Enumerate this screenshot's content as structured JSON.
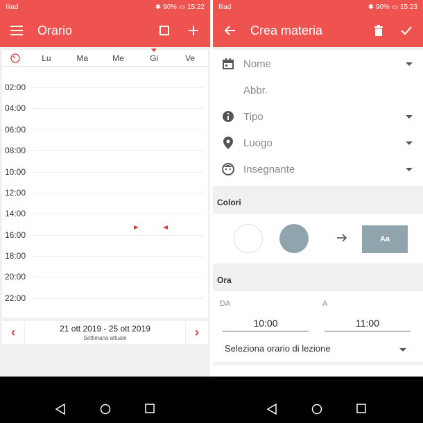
{
  "left": {
    "status": {
      "carrier": "Iliad",
      "battery": "90%",
      "time": "15:22"
    },
    "appbar": {
      "title": "Orario"
    },
    "days": [
      "Lu",
      "Ma",
      "Me",
      "Gi",
      "Ve"
    ],
    "hours": [
      "02:00",
      "04:00",
      "06:00",
      "08:00",
      "10:00",
      "12:00",
      "14:00",
      "16:00",
      "18:00",
      "20:00",
      "22:00"
    ],
    "week": {
      "range": "21 ott 2019 - 25 ott 2019",
      "sub": "Settimana attuale"
    }
  },
  "right": {
    "status": {
      "carrier": "Iliad",
      "battery": "90%",
      "time": "15:23"
    },
    "appbar": {
      "title": "Crea materia"
    },
    "fields": {
      "nome": "Nome",
      "abbr": "Abbr.",
      "tipo": "Tipo",
      "luogo": "Luogo",
      "insegnante": "Insegnante"
    },
    "colors_title": "Colori",
    "preview_label": "Aa",
    "ora_title": "Ora",
    "from_label": "DA",
    "to_label": "A",
    "from_time": "10:00",
    "to_time": "11:00",
    "select_label": "Seleziona orario di lezione"
  },
  "colors": {
    "accent": "#ef5350",
    "marker": "#e53935",
    "swatch": "#90a4ae"
  }
}
